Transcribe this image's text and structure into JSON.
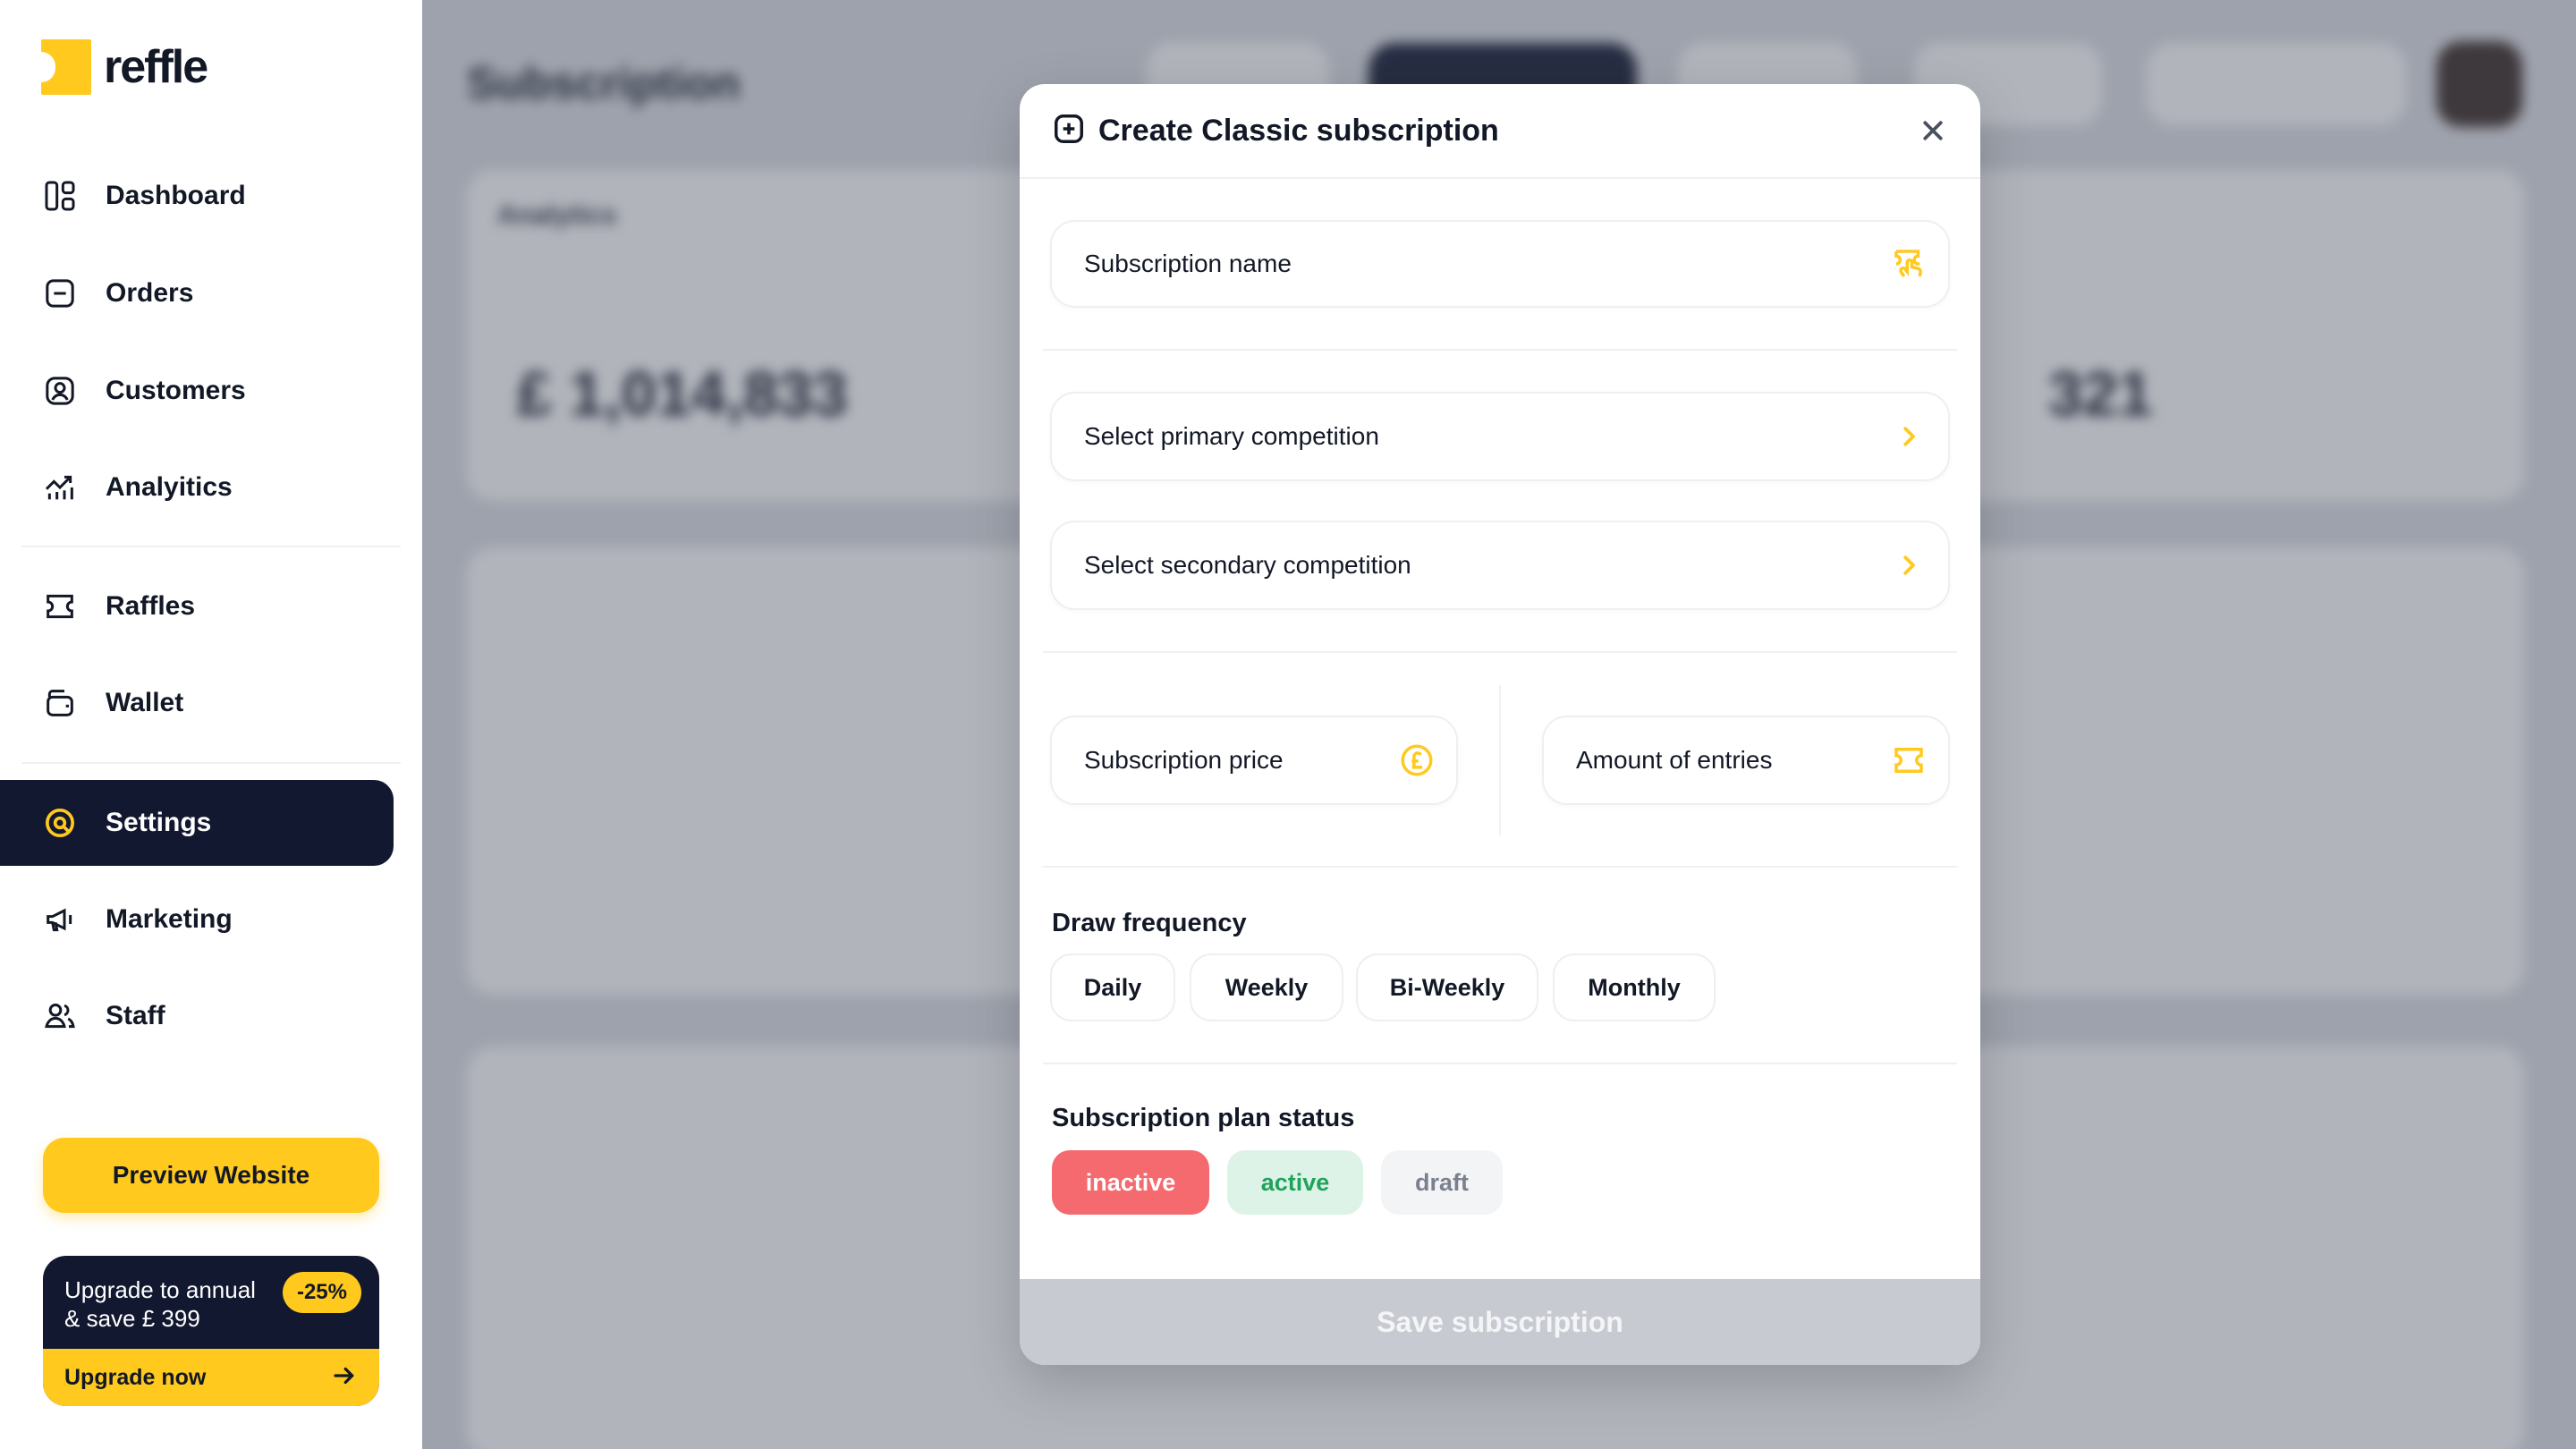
{
  "brand": {
    "name": "reffle",
    "accent": "#FFC91E",
    "dark": "#121830"
  },
  "sidebar": {
    "items": [
      {
        "label": "Dashboard",
        "icon": "dashboard-icon"
      },
      {
        "label": "Orders",
        "icon": "orders-icon"
      },
      {
        "label": "Customers",
        "icon": "customers-icon"
      },
      {
        "label": "Analyitics",
        "icon": "analytics-icon"
      },
      {
        "label": "Raffles",
        "icon": "ticket-icon"
      },
      {
        "label": "Wallet",
        "icon": "wallet-icon"
      },
      {
        "label": "Settings",
        "icon": "settings-icon",
        "active": true
      },
      {
        "label": "Marketing",
        "icon": "megaphone-icon"
      },
      {
        "label": "Staff",
        "icon": "staff-icon"
      }
    ],
    "preview_label": "Preview Website",
    "upgrade": {
      "line1": "Upgrade to annual",
      "line2": "& save £ 399",
      "discount": "-25%",
      "cta": "Upgrade now"
    }
  },
  "background": {
    "page_title": "Subscription",
    "revenue_value": "£ 1,014,833",
    "subscribers_value": "321"
  },
  "modal": {
    "title": "Create Classic subscription",
    "fields": {
      "name_placeholder": "Subscription name",
      "primary_competition": "Select primary competition",
      "secondary_competition": "Select secondary competition",
      "price_placeholder": "Subscription price",
      "entries_placeholder": "Amount of entries"
    },
    "draw_frequency": {
      "label": "Draw frequency",
      "options": [
        "Daily",
        "Weekly",
        "Bi-Weekly",
        "Monthly"
      ]
    },
    "plan_status": {
      "label": "Subscription plan status",
      "options": [
        "inactive",
        "active",
        "draft"
      ],
      "selected": "inactive"
    },
    "save_label": "Save subscription"
  }
}
